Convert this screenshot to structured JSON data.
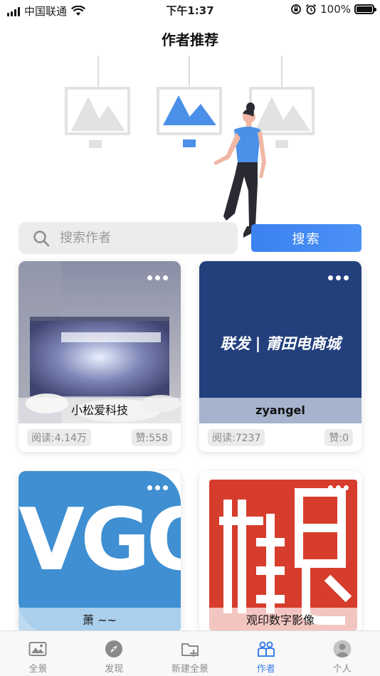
{
  "status_bar": {
    "carrier": "中国联通",
    "time": "下午1:37",
    "battery": "100%"
  },
  "page_title": "作者推荐",
  "search": {
    "placeholder": "搜索作者",
    "button_label": "搜索"
  },
  "authors": [
    {
      "name": "小松爱科技",
      "reads": "阅读:4.14万",
      "likes": "赞:558"
    },
    {
      "name": "zyangel",
      "reads": "阅读:7237",
      "likes": "赞:0",
      "banner_text": "联发 | 莆田电商城"
    },
    {
      "name": "萧 ~~",
      "banner_text": "VGO"
    },
    {
      "name": "观印数字影像"
    }
  ],
  "tabs": [
    {
      "label": "全景",
      "icon": "panorama-icon"
    },
    {
      "label": "发现",
      "icon": "compass-icon"
    },
    {
      "label": "新建全景",
      "icon": "new-folder-icon"
    },
    {
      "label": "作者",
      "icon": "authors-icon",
      "active": true
    },
    {
      "label": "个人",
      "icon": "profile-icon"
    }
  ],
  "colors": {
    "accent": "#3a7de8",
    "inactive_tab": "#8a8a8a"
  }
}
